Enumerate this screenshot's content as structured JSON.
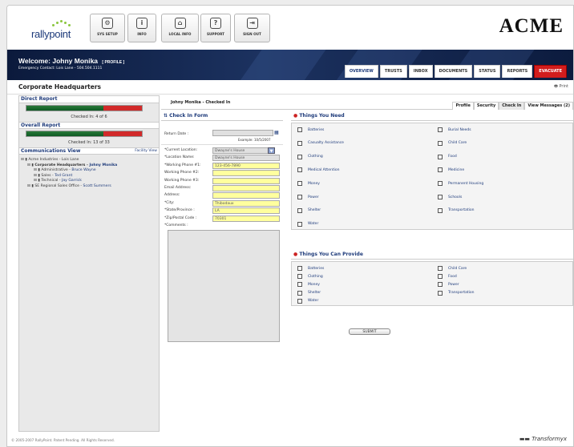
{
  "app": {
    "logo_text": "rallypoint",
    "brand": "ACME"
  },
  "toolbar": [
    {
      "label": "SYS SETUP",
      "icon": "gear-icon",
      "glyph": "⚙"
    },
    {
      "label": "INFO",
      "icon": "info-icon",
      "glyph": "i"
    },
    {
      "label": "LOCAL INFO",
      "icon": "local-info-icon",
      "glyph": "⌂"
    },
    {
      "label": "SUPPORT",
      "icon": "support-icon",
      "glyph": "?"
    },
    {
      "label": "SIGN OUT",
      "icon": "sign-out-icon",
      "glyph": "⇥"
    }
  ],
  "header": {
    "welcome": "Welcome: Johny Monika",
    "profile_link": "[ PROFILE ]",
    "emergency": "Emergency Contact: Lois Lane - 504.504.1111"
  },
  "main_tabs": [
    "OVERVIEW",
    "TRUSTS",
    "INBOX",
    "DOCUMENTS",
    "STATUS",
    "REPORTS",
    "EVACUATE"
  ],
  "subheader": {
    "title": "Corporate Headquarters",
    "print": "Print"
  },
  "sidebar": {
    "direct_report": {
      "title": "Direct Report",
      "checked": "Checked In: 4 of 6",
      "progress": 0.67
    },
    "overall_report": {
      "title": "Overall Report",
      "checked": "Checked In: 13 of 33",
      "progress": 0.67
    },
    "comm_view": {
      "title": "Communications View",
      "facility": "Facility View"
    },
    "tree": [
      {
        "label": "Acme Industries - Lois Lane",
        "indent": 0
      },
      {
        "label": "Corporate Headquarters - ",
        "person": "Johny Monika",
        "indent": 1,
        "bold": true
      },
      {
        "label": "Administrative - ",
        "person": "Bruce Wayne",
        "indent": 2
      },
      {
        "label": "Sales - ",
        "person": "Ted Grant",
        "indent": 2
      },
      {
        "label": "Technical - ",
        "person": "Jay Garrick",
        "indent": 2
      },
      {
        "label": "SE Regional Sales Office - ",
        "person": "Scott Summers",
        "indent": 1
      }
    ]
  },
  "content": {
    "person_title": "Johny Monika - Checked In",
    "profile_tabs": [
      "Profile",
      "Security",
      "Check In",
      "View Messages (2)"
    ]
  },
  "checkin_form": {
    "title": "Check In Form",
    "return_date_label": "Return Date :",
    "return_date_example": "Example: 10/5/2007",
    "fields": [
      {
        "label": "*Current Location:",
        "value": "Dwayne's House",
        "style": "g"
      },
      {
        "label": "*Location Name:",
        "value": "Dwayne's House",
        "style": "g"
      },
      {
        "label": "*Working Phone #1:",
        "value": "123-456-7890",
        "style": "y"
      },
      {
        "label": "Working Phone #2:",
        "value": "",
        "style": "y"
      },
      {
        "label": "Working Phone #3:",
        "value": "",
        "style": "y"
      },
      {
        "label": "Email Address:",
        "value": "",
        "style": "y"
      },
      {
        "label": "Address:",
        "value": "",
        "style": "y"
      },
      {
        "label": "*City:",
        "value": "Thibodaux",
        "style": "y"
      },
      {
        "label": "*State/Province :",
        "value": "LA",
        "style": "y"
      },
      {
        "label": "*Zip/Postal Code :",
        "value": "70301",
        "style": "y"
      }
    ],
    "comments_label": "*Comments :"
  },
  "things_need": {
    "title": "Things You Need",
    "left": [
      "Batteries",
      "Casualty Assistance",
      "Clothing",
      "Medical Attention",
      "Money",
      "Power",
      "Shelter",
      "Water"
    ],
    "right": [
      "Burial Needs",
      "Child Care",
      "Food",
      "Medicine",
      "Permanent Housing",
      "Schools",
      "Transportation"
    ]
  },
  "things_provide": {
    "title": "Things You Can Provide",
    "left": [
      "Batteries",
      "Clothing",
      "Money",
      "Shelter",
      "Water"
    ],
    "right": [
      "Child Care",
      "Food",
      "Power",
      "Transportation"
    ]
  },
  "submit_label": "SUBMIT",
  "footer": {
    "copyright": "© 2005-2007 RallyPoint. Patent Pending. All Rights Reserved.",
    "brand": "Transformyx"
  },
  "colors": {
    "navy": "#1c3260",
    "evacuate": "#d21d1d",
    "accent_blue": "#1d3a7a",
    "required_field": "#ffff9e"
  }
}
